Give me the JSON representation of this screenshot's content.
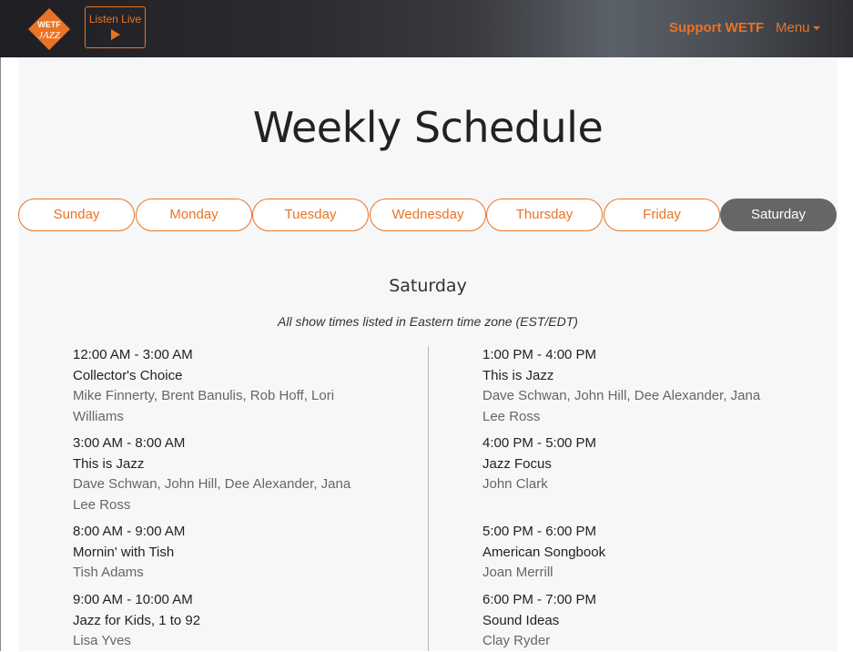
{
  "header": {
    "logo": {
      "top": "WETF",
      "bottom": "JAZZ"
    },
    "listen_live_label": "Listen Live",
    "support_label": "Support WETF",
    "menu_label": "Menu"
  },
  "page_title": "Weekly Schedule",
  "tabs": [
    {
      "label": "Sunday",
      "active": false
    },
    {
      "label": "Monday",
      "active": false
    },
    {
      "label": "Tuesday",
      "active": false
    },
    {
      "label": "Wednesday",
      "active": false
    },
    {
      "label": "Thursday",
      "active": false
    },
    {
      "label": "Friday",
      "active": false
    },
    {
      "label": "Saturday",
      "active": true
    }
  ],
  "day_heading": "Saturday",
  "timezone_note": "All show times listed in Eastern time zone (EST/EDT)",
  "schedule": {
    "left": [
      {
        "time": "12:00 AM - 3:00 AM",
        "show": "Collector's Choice",
        "hosts": "Mike Finnerty, Brent Banulis, Rob Hoff, Lori Williams"
      },
      {
        "time": "3:00 AM - 8:00 AM",
        "show": "This is Jazz",
        "hosts": "Dave Schwan, John Hill, Dee Alexander, Jana Lee Ross"
      },
      {
        "time": "8:00 AM - 9:00 AM",
        "show": "Mornin' with Tish",
        "hosts": "Tish Adams"
      },
      {
        "time": "9:00 AM - 10:00 AM",
        "show": "Jazz for Kids, 1 to 92",
        "hosts": "Lisa Yves"
      }
    ],
    "right": [
      {
        "time": "1:00 PM - 4:00 PM",
        "show": "This is Jazz",
        "hosts": "Dave Schwan, John Hill, Dee Alexander, Jana Lee Ross"
      },
      {
        "time": "4:00 PM - 5:00 PM",
        "show": "Jazz Focus",
        "hosts": "John Clark"
      },
      {
        "time": "5:00 PM - 6:00 PM",
        "show": "American Songbook",
        "hosts": "Joan Merrill"
      },
      {
        "time": "6:00 PM - 7:00 PM",
        "show": "Sound Ideas",
        "hosts": "Clay Ryder"
      }
    ]
  },
  "colors": {
    "accent": "#ea7325",
    "active_tab": "#666666",
    "content_bg": "#f6f7f9",
    "host_text": "#666666"
  }
}
